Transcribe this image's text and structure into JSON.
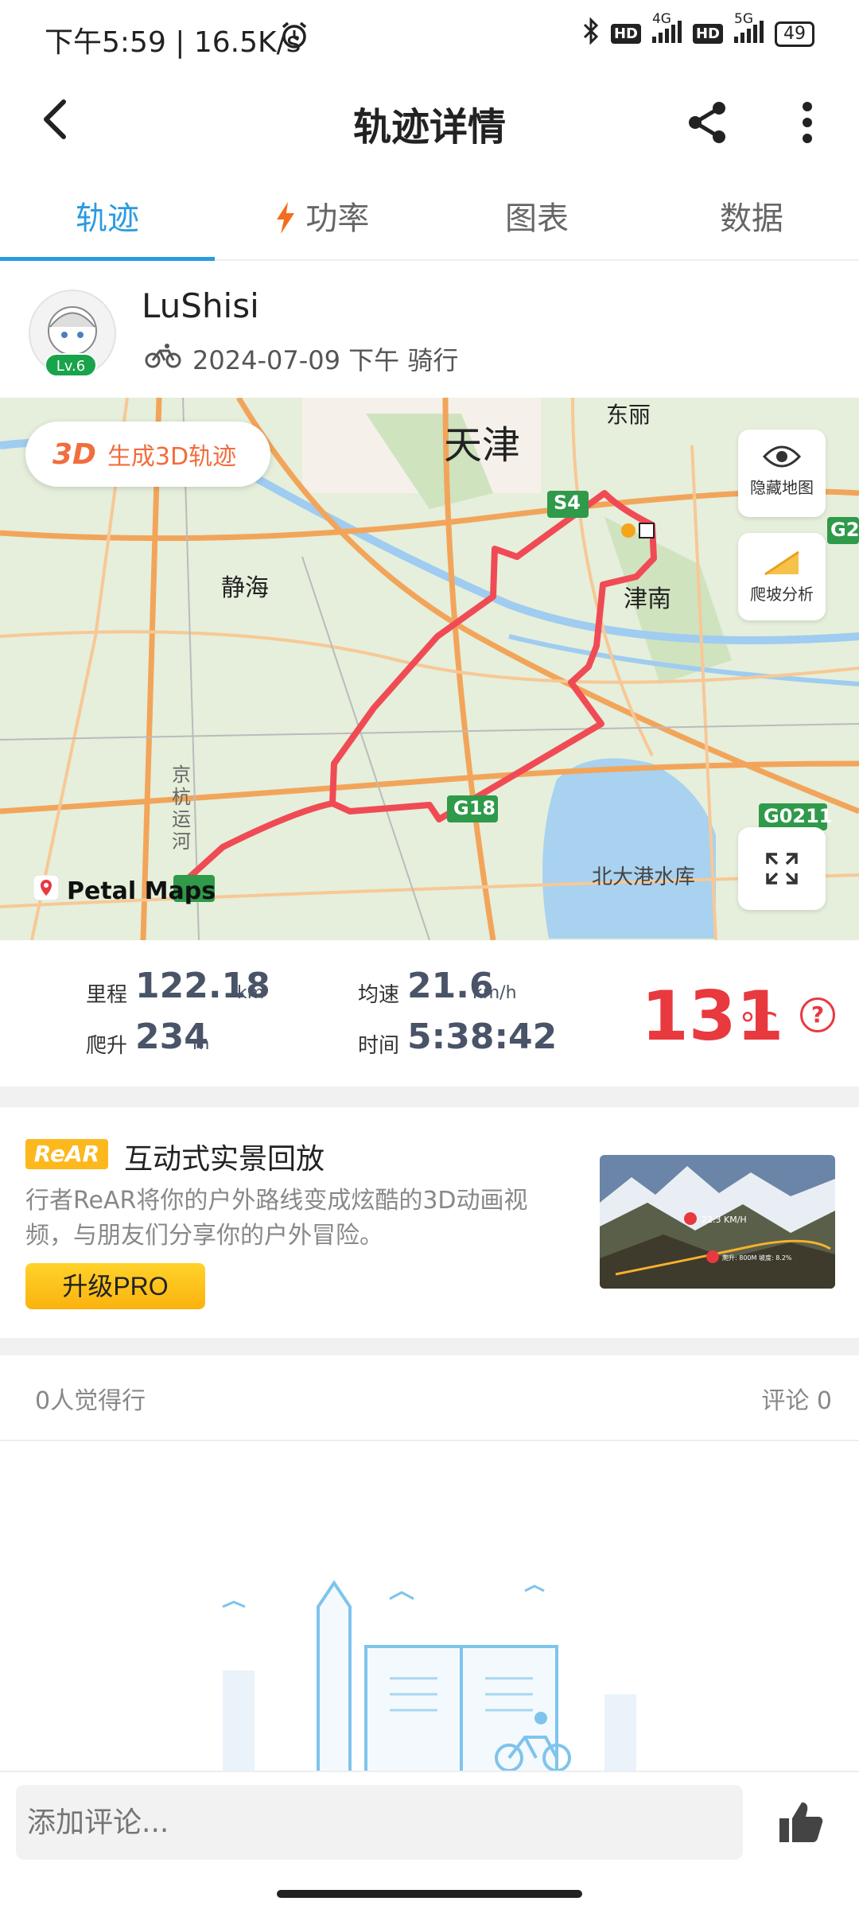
{
  "status_bar": {
    "time_speed": "下午5:59 | 16.5K/s",
    "net1": "4G",
    "net2": "5G",
    "hd": "HD",
    "battery": "49"
  },
  "header": {
    "title": "轨迹详情"
  },
  "tabs": [
    {
      "label": "轨迹",
      "active": true
    },
    {
      "label": "功率",
      "active": false
    },
    {
      "label": "图表",
      "active": false
    },
    {
      "label": "数据",
      "active": false
    }
  ],
  "user": {
    "name": "LuShisi",
    "level": "Lv.6",
    "meta": "2024-07-09 下午 骑行"
  },
  "map": {
    "btn_3d_prefix": "3D",
    "btn_3d_label": "生成3D轨迹",
    "hide_map_label": "隐藏地图",
    "climb_label": "爬坡分析",
    "brand": "Petal Maps",
    "places": [
      "天津",
      "东丽",
      "静海",
      "津南",
      "北大港水库",
      "京杭运河"
    ],
    "roads": [
      "S4",
      "G18",
      "G0211",
      "G2"
    ]
  },
  "stats": {
    "distance_label": "里程",
    "distance_value": "122.18",
    "distance_unit": "km",
    "climb_label": "爬升",
    "climb_value": "234",
    "climb_unit": "m",
    "speed_label": "均速",
    "speed_value": "21.6",
    "speed_unit": "km/h",
    "time_label": "时间",
    "time_value": "5:38:42",
    "temp_value": "131",
    "temp_unit": "°C",
    "help": "?"
  },
  "rear": {
    "logo": "ReAR",
    "title": "互动式实景回放",
    "desc": "行者ReAR将你的户外路线变成炫酷的3D动画视频，与朋友们分享你的户外冒险。",
    "upgrade_label": "升级PRO",
    "thumb_speed": "22.3 KM/H",
    "thumb_info": "爬升: 800M  坡度: 8.2%"
  },
  "social": {
    "likes": "0人觉得行",
    "comments": "评论 0"
  },
  "comment": {
    "placeholder": "添加评论..."
  },
  "colors": {
    "accent": "#2b9be0",
    "route": "#f04b55",
    "temp": "#e8393f",
    "pro": "#fcb81d"
  }
}
